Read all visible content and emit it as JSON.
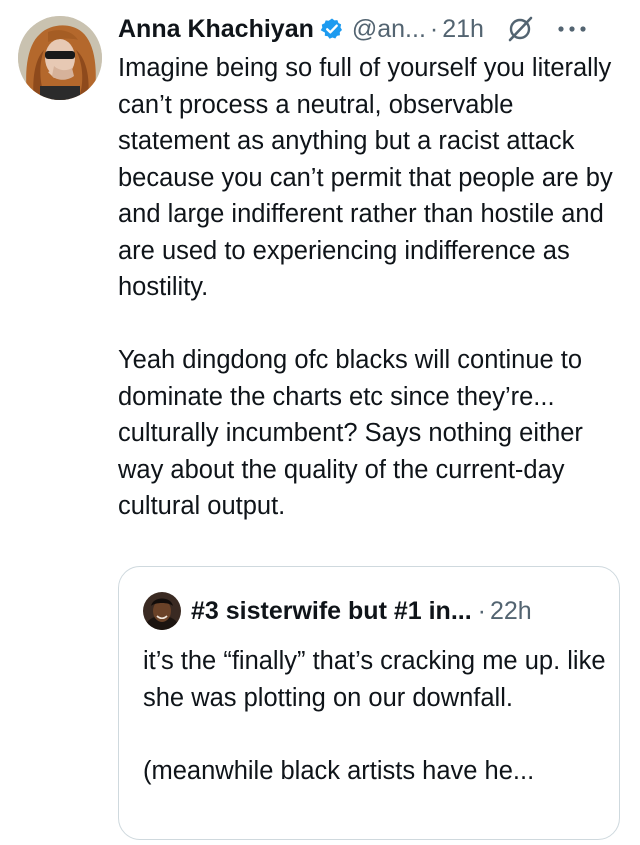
{
  "tweet": {
    "author_name": "Anna Khachiyan",
    "handle": "@an...",
    "separator": "·",
    "time": "21h",
    "avatar_icon": "profile-photo-avatar",
    "verified_icon": "verified-badge-icon",
    "grok_icon": "grok-icon",
    "more_icon": "more-dots-icon",
    "paragraphs": [
      "Imagine being so full of yourself you literally can’t process a neutral, observable statement as anything but a racist attack because you can’t permit that people are by and large indifferent rather than hostile and are used to experiencing indifference as hostility.",
      "Yeah dingdong ofc blacks will continue to dominate the charts etc since they’re... culturally incumbent? Says nothing either way about the quality of the current-day cultural output."
    ]
  },
  "quoted": {
    "author_name": "#3 sisterwife but #1 in...",
    "separator": "·",
    "time": "22h",
    "avatar_icon": "profile-photo-avatar",
    "paragraphs": [
      "it’s the “finally” that’s cracking me up. like she was plotting on our downfall.",
      "(meanwhile black artists have he..."
    ]
  },
  "colors": {
    "text": "#0f1419",
    "secondary": "#536471",
    "verified": "#1d9bf0",
    "border": "#cfd9de"
  }
}
